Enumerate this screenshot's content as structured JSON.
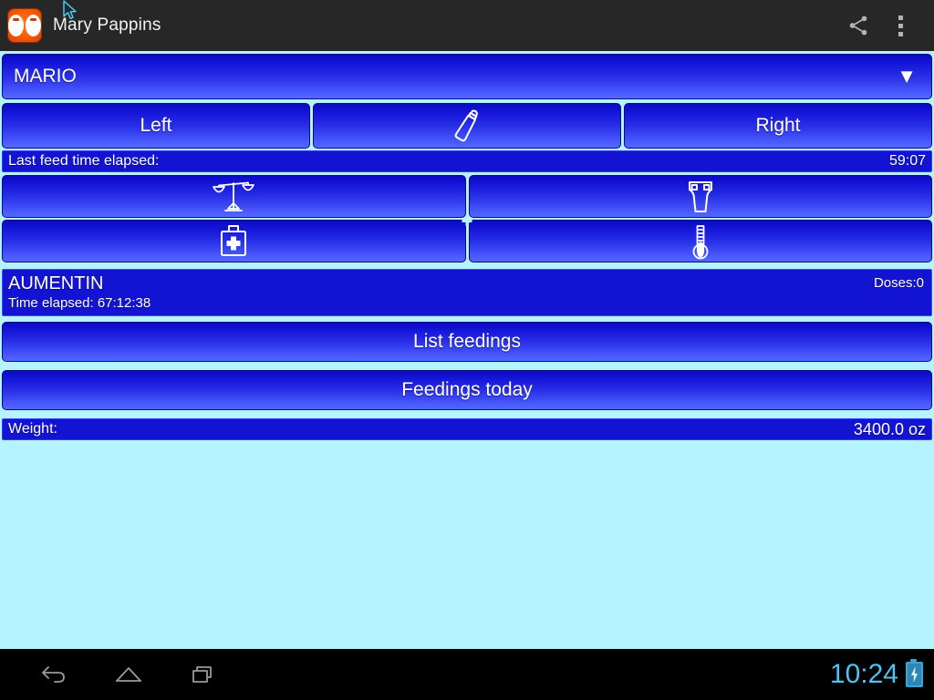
{
  "app": {
    "title": "Mary Pappins",
    "icon": "app-logo-icon",
    "share_icon": "share-icon",
    "overflow_icon": "overflow-menu-icon"
  },
  "colors": {
    "background": "#b5f4ff",
    "button_top": "#0a0ac4",
    "button_bottom": "#5468ff",
    "bar_fill": "#1313d4",
    "actionbar": "#272727",
    "accent_icon": "#ffffff",
    "clock": "#4ec3ef"
  },
  "spinner": {
    "selected": "MARIO",
    "caret": "▼"
  },
  "feed_buttons": {
    "left": "Left",
    "bottle_icon": "baby-bottle-icon",
    "right": "Right"
  },
  "elapsed_bar": {
    "label": "Last feed time elapsed:",
    "value": "59:07"
  },
  "icon_grid": [
    {
      "name": "scale-icon",
      "label": "Weight"
    },
    {
      "name": "diaper-icon",
      "label": "Diaper"
    },
    {
      "name": "medicine-kit-icon",
      "label": "Medicine"
    },
    {
      "name": "thermometer-icon",
      "label": "Temperature"
    }
  ],
  "medicine": {
    "name": "AUMENTIN",
    "doses": "Doses:0",
    "time_elapsed": "Time elapsed: 67:12:38"
  },
  "actions": {
    "list_feedings": "List feedings",
    "feedings_today": "Feedings today"
  },
  "weight_bar": {
    "label": "Weight:",
    "value": "3400.0 oz"
  },
  "navbar": {
    "back_icon": "back-icon",
    "home_icon": "home-icon",
    "recents_icon": "recents-icon",
    "clock": "10:24",
    "battery_icon": "battery-charging-icon"
  }
}
